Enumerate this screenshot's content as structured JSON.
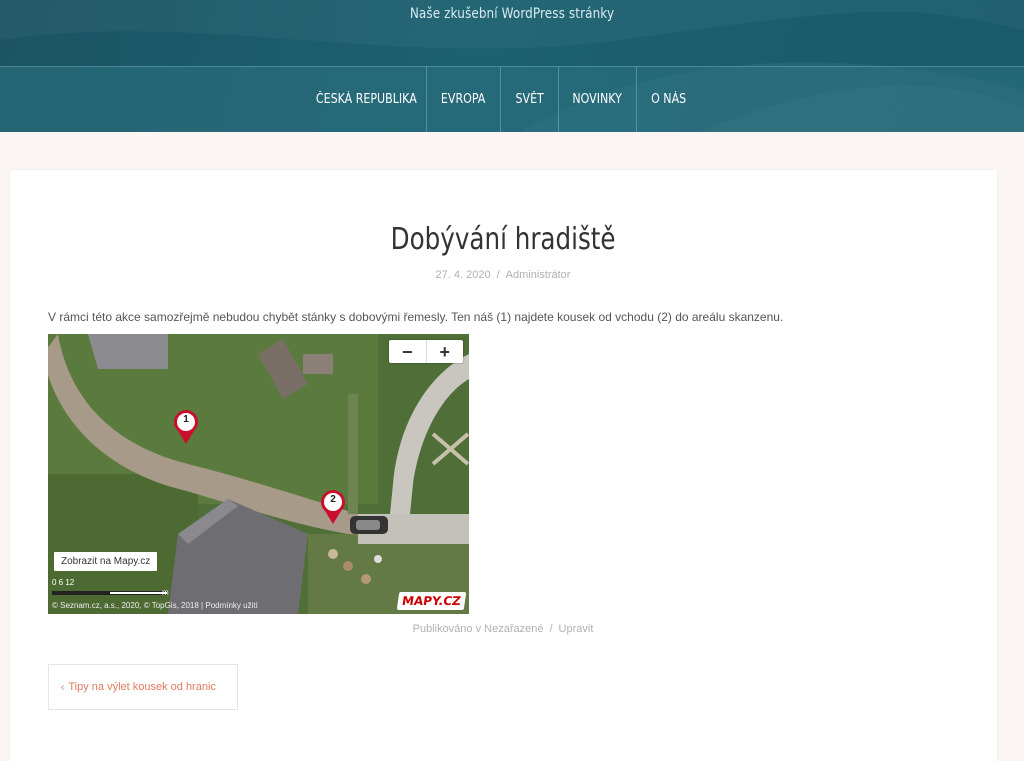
{
  "site": {
    "tagline": "Naše zkušební WordPress stránky"
  },
  "nav": {
    "items": [
      {
        "label": "ČESKÁ REPUBLIKA"
      },
      {
        "label": "EVROPA"
      },
      {
        "label": "SVĚT"
      },
      {
        "label": "NOVINKY"
      },
      {
        "label": "O NÁS"
      }
    ]
  },
  "post": {
    "title": "Dobývání hradiště",
    "date": "27. 4. 2020",
    "meta_separator": "/",
    "author": "Administrátor",
    "text": "V rámci této akce samozřejmě nebudou chybět stánky s dobovými řemesly. Ten náš (1) najdete kousek od vchodu (2) do areálu skanzenu.",
    "categories": "Publikováno v Nezařazené",
    "footer_separator": "/",
    "edit_label": "Upravit"
  },
  "map": {
    "zoom_out": "−",
    "zoom_in": "+",
    "open_link": "Zobrazit na Mapy.cz",
    "markers": [
      {
        "label": "1"
      },
      {
        "label": "2"
      }
    ],
    "scale_labels": "0        6        12",
    "scale_unit": "m",
    "attribution": "© Seznam.cz, a.s., 2020, © TopGis, 2018 | Podmínky užití",
    "logo": "MAPY.CZ",
    "colors": {
      "marker": "#c8102e",
      "grass": "#4f6d36",
      "road": "#a79b8b"
    }
  },
  "post_navigation": {
    "previous_chevron": "‹",
    "previous_label": "Tipy na výlet kousek od hranic"
  },
  "colors": {
    "header": "#1c5463",
    "accent": "#e07a5f",
    "page_bg": "#fbf5f4"
  }
}
